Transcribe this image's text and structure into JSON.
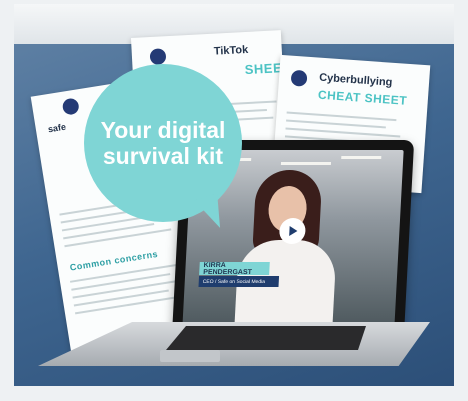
{
  "bubble": {
    "line1": "Your digital",
    "line2": "survival kit"
  },
  "sheets": {
    "tiktok": {
      "title": "TikTok",
      "subtitle": "SHEET"
    },
    "cyber": {
      "title": "Cyberbullying",
      "subtitle": "CHEAT SHEET"
    },
    "safety": {
      "heading": "safe",
      "section": "Common concerns"
    }
  },
  "video": {
    "presenter_name": "KIRRA PENDERGAST",
    "presenter_role": "CEO / Safe on Social Media"
  },
  "colors": {
    "accent": "#7fd5d5",
    "navy": "#243a75",
    "background": "#3f6690"
  }
}
